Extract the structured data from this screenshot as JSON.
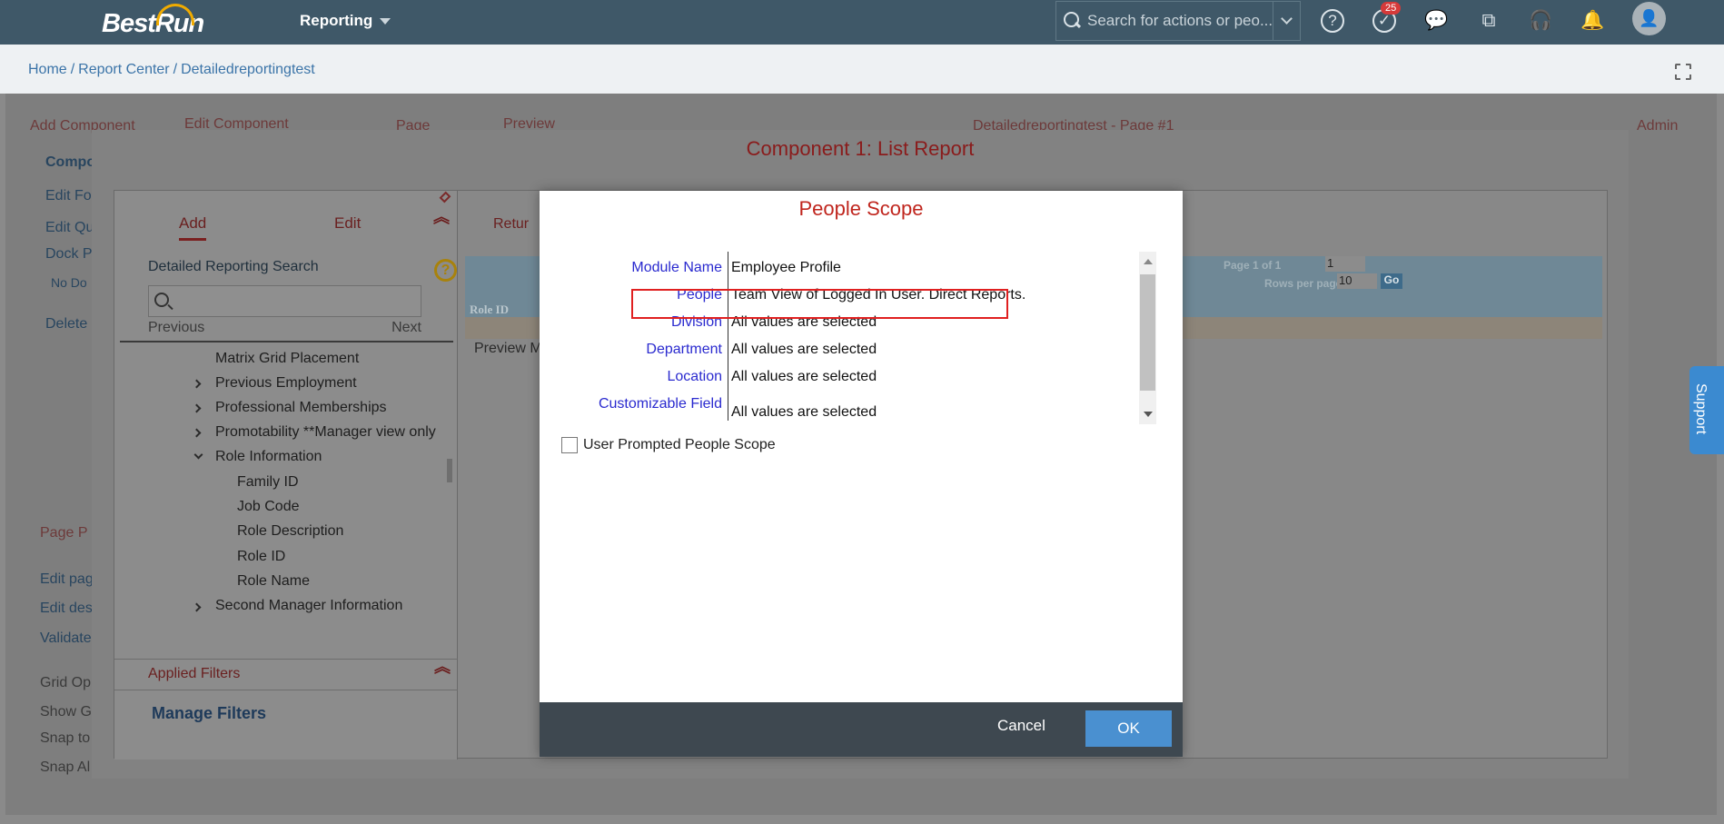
{
  "shell": {
    "logo": "BestRun",
    "app_menu": "Reporting",
    "search_placeholder": "Search for actions or peo...",
    "notification_count": "25"
  },
  "breadcrumb": [
    "Home",
    "Report Center",
    "Detailedreportingtest"
  ],
  "background": {
    "add_component": "Add Component",
    "edit_component": "Edit Component",
    "page": "Page",
    "preview": "Preview",
    "page_title": "Detailedreportingtest - Page #1",
    "admin": "Admin",
    "compo": "Compo",
    "edit_fo": "Edit Fo",
    "edit_qu": "Edit Qu",
    "dock_p": "Dock P",
    "no_do": "No Do",
    "delete": "Delete",
    "page_p": "Page P",
    "edit_page": "Edit pag",
    "edit_des": "Edit des",
    "validate": "Validate",
    "grid_op": "Grid Op",
    "show_g": "Show G",
    "snap_to": "Snap to",
    "snap_al": "Snap Al"
  },
  "outer_modal": {
    "title": "Component 1: List Report",
    "tabs": {
      "add": "Add",
      "edit": "Edit",
      "return": "Retur"
    },
    "search_label": "Detailed Reporting Search",
    "help": "?",
    "previous": "Previous",
    "next": "Next",
    "tree": [
      "Matrix Grid Placement",
      "Previous Employment",
      "Professional Memberships",
      "Promotability **Manager view only",
      "Role Information",
      "Family ID",
      "Job Code",
      "Role Description",
      "Role ID",
      "Role Name",
      "Second Manager Information"
    ],
    "applied_filters": "Applied Filters",
    "manage_filters": "Manage Filters",
    "preview_label": "Preview M",
    "role_id_header": "Role ID",
    "page_of": "Page 1 of 1",
    "page_value": "1",
    "rows_per_page": "Rows per page:",
    "rows_value": "10",
    "go": "Go"
  },
  "people_scope": {
    "title": "People Scope",
    "rows": [
      {
        "label": "Module Name",
        "value": "Employee Profile"
      },
      {
        "label": "People",
        "value": "Team View of Logged In User. Direct Reports."
      },
      {
        "label": "Division",
        "value": "All values are selected"
      },
      {
        "label": "Department",
        "value": "All values are selected"
      },
      {
        "label": "Location",
        "value": "All values are selected"
      },
      {
        "label": "Customizable Field",
        "value": "All values are selected"
      }
    ],
    "checkbox_label": "User Prompted People Scope",
    "cancel": "Cancel",
    "ok": "OK"
  },
  "support": "Support"
}
